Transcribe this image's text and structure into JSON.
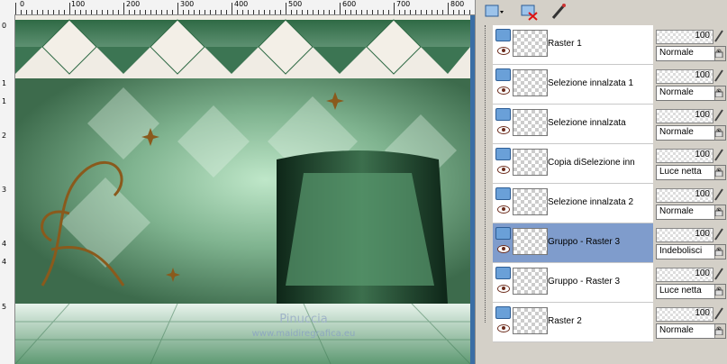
{
  "rulers": {
    "top": [
      "0",
      "100",
      "200",
      "300",
      "400",
      "500",
      "600",
      "700",
      "800"
    ],
    "left": [
      "0",
      "1",
      "1",
      "2",
      "3",
      "4",
      "4",
      "5"
    ]
  },
  "watermark": {
    "line1": "Pinuccia",
    "line2": "www.maidiregrafica.eu"
  },
  "toolbar": {
    "icons": [
      "layer-type-icon",
      "delete-layer-icon",
      "edit-brush-icon"
    ]
  },
  "layers": [
    {
      "name": "Raster 1",
      "opacity": "100",
      "blend": "Normale",
      "selected": false
    },
    {
      "name": "Selezione innalzata 1",
      "opacity": "100",
      "blend": "Normale",
      "selected": false
    },
    {
      "name": "Selezione innalzata",
      "opacity": "100",
      "blend": "Normale",
      "selected": false
    },
    {
      "name": "Copia diSelezione inn",
      "opacity": "100",
      "blend": "Luce netta",
      "selected": false
    },
    {
      "name": "Selezione innalzata 2",
      "opacity": "100",
      "blend": "Normale",
      "selected": false
    },
    {
      "name": "Gruppo - Raster 3",
      "opacity": "100",
      "blend": "Indebolisci",
      "selected": true
    },
    {
      "name": "Gruppo - Raster 3",
      "opacity": "100",
      "blend": "Luce netta",
      "selected": false
    },
    {
      "name": "Raster 2",
      "opacity": "100",
      "blend": "Normale",
      "selected": false
    }
  ]
}
